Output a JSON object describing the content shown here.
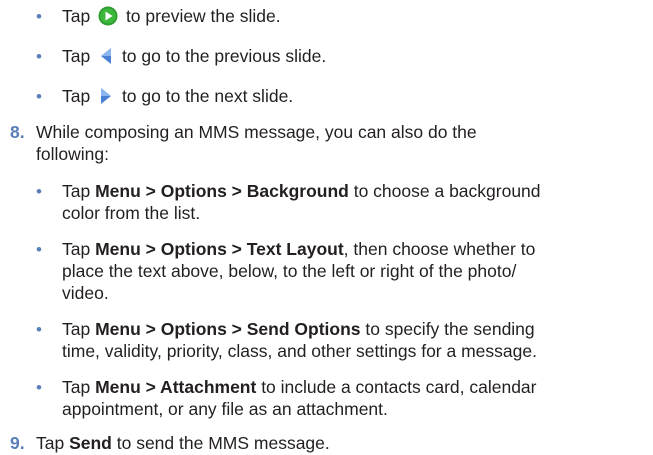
{
  "top_bullets": [
    {
      "pre": "Tap ",
      "icon": "play-icon",
      "post": " to preview the slide."
    },
    {
      "pre": "Tap ",
      "icon": "previous-arrow-icon",
      "post": " to go to the previous slide."
    },
    {
      "pre": "Tap ",
      "icon": "next-arrow-icon",
      "post": " to go to the next slide."
    }
  ],
  "step8": {
    "number": "8.",
    "line1": "While composing an MMS message, you can also do the",
    "line2": "following:",
    "bullets": [
      {
        "tap": "Tap ",
        "bold": "Menu > Options > Background",
        "rest1": " to choose a background",
        "line2": "color from the list."
      },
      {
        "tap": "Tap ",
        "bold": "Menu > Options > Text Layout",
        "rest1": ", then choose whether to",
        "line2": "place the text above, below, to the left or right of the photo/",
        "line3": "video."
      },
      {
        "tap": "Tap ",
        "bold": "Menu > Options > Send Options",
        "rest1": " to specify the sending",
        "line2": "time, validity, priority, class, and other settings for a message."
      },
      {
        "tap": "Tap ",
        "bold": "Menu > Attachment",
        "rest1": " to include a contacts card, calendar",
        "line2": "appointment, or any file as an attachment."
      }
    ]
  },
  "step9": {
    "number": "9.",
    "tap": "Tap ",
    "bold": "Send",
    "rest": " to send the MMS message."
  },
  "colors": {
    "bullet": "#5a7fb8",
    "play_icon": "#2e9e2e",
    "arrow_icon": "#4a7fd4"
  }
}
